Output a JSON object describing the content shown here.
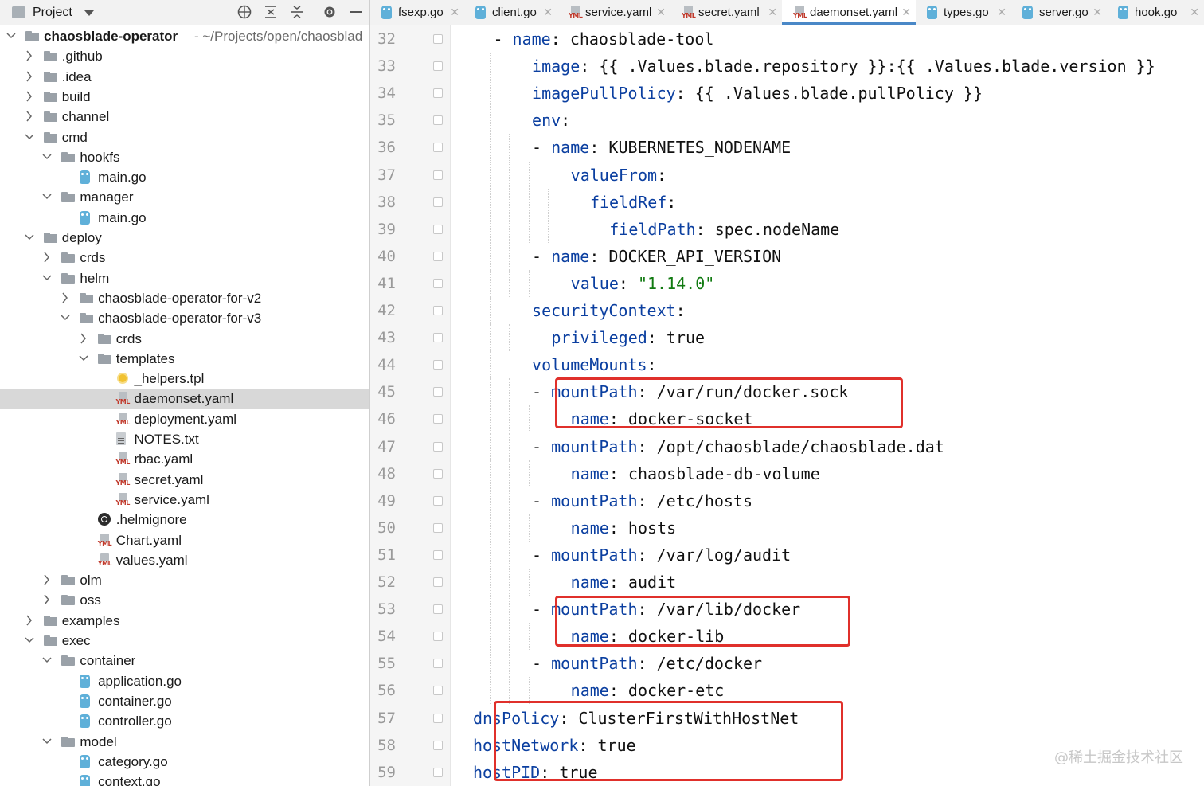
{
  "project_panel": {
    "title": "Project",
    "tree": [
      {
        "label": "chaosblade-operator",
        "hint": "- ~/Projects/open/chaosblad",
        "depth": 0,
        "expanded": true,
        "type": "module"
      },
      {
        "label": ".github",
        "depth": 1,
        "expanded": false,
        "type": "folder"
      },
      {
        "label": ".idea",
        "depth": 1,
        "expanded": false,
        "type": "folder"
      },
      {
        "label": "build",
        "depth": 1,
        "expanded": false,
        "type": "folder"
      },
      {
        "label": "channel",
        "depth": 1,
        "expanded": false,
        "type": "folder"
      },
      {
        "label": "cmd",
        "depth": 1,
        "expanded": true,
        "type": "folder"
      },
      {
        "label": "hookfs",
        "depth": 2,
        "expanded": true,
        "type": "folder"
      },
      {
        "label": "main.go",
        "depth": 3,
        "type": "go"
      },
      {
        "label": "manager",
        "depth": 2,
        "expanded": true,
        "type": "folder"
      },
      {
        "label": "main.go",
        "depth": 3,
        "type": "go"
      },
      {
        "label": "deploy",
        "depth": 1,
        "expanded": true,
        "type": "folder"
      },
      {
        "label": "crds",
        "depth": 2,
        "expanded": false,
        "type": "folder"
      },
      {
        "label": "helm",
        "depth": 2,
        "expanded": true,
        "type": "folder"
      },
      {
        "label": "chaosblade-operator-for-v2",
        "depth": 3,
        "expanded": false,
        "type": "folder"
      },
      {
        "label": "chaosblade-operator-for-v3",
        "depth": 3,
        "expanded": true,
        "type": "folder"
      },
      {
        "label": "crds",
        "depth": 4,
        "expanded": false,
        "type": "folder"
      },
      {
        "label": "templates",
        "depth": 4,
        "expanded": true,
        "type": "folder"
      },
      {
        "label": "_helpers.tpl",
        "depth": 5,
        "type": "tpl"
      },
      {
        "label": "daemonset.yaml",
        "depth": 5,
        "type": "yml",
        "selected": true
      },
      {
        "label": "deployment.yaml",
        "depth": 5,
        "type": "yml"
      },
      {
        "label": "NOTES.txt",
        "depth": 5,
        "type": "txt"
      },
      {
        "label": "rbac.yaml",
        "depth": 5,
        "type": "yml"
      },
      {
        "label": "secret.yaml",
        "depth": 5,
        "type": "yml"
      },
      {
        "label": "service.yaml",
        "depth": 5,
        "type": "yml"
      },
      {
        "label": ".helmignore",
        "depth": 4,
        "type": "helm"
      },
      {
        "label": "Chart.yaml",
        "depth": 4,
        "type": "yml"
      },
      {
        "label": "values.yaml",
        "depth": 4,
        "type": "yml"
      },
      {
        "label": "olm",
        "depth": 2,
        "expanded": false,
        "type": "folder"
      },
      {
        "label": "oss",
        "depth": 2,
        "expanded": false,
        "type": "folder"
      },
      {
        "label": "examples",
        "depth": 1,
        "expanded": false,
        "type": "folder"
      },
      {
        "label": "exec",
        "depth": 1,
        "expanded": true,
        "type": "folder"
      },
      {
        "label": "container",
        "depth": 2,
        "expanded": true,
        "type": "folder"
      },
      {
        "label": "application.go",
        "depth": 3,
        "type": "go"
      },
      {
        "label": "container.go",
        "depth": 3,
        "type": "go"
      },
      {
        "label": "controller.go",
        "depth": 3,
        "type": "go"
      },
      {
        "label": "model",
        "depth": 2,
        "expanded": true,
        "type": "folder"
      },
      {
        "label": "category.go",
        "depth": 3,
        "type": "go"
      },
      {
        "label": "context.go",
        "depth": 3,
        "type": "go"
      }
    ]
  },
  "tabs": [
    {
      "label": "fsexp.go",
      "icon": "go"
    },
    {
      "label": "client.go",
      "icon": "go"
    },
    {
      "label": "service.yaml",
      "icon": "yml"
    },
    {
      "label": "secret.yaml",
      "icon": "yml"
    },
    {
      "label": "daemonset.yaml",
      "icon": "yml",
      "active": true
    },
    {
      "label": "types.go",
      "icon": "go"
    },
    {
      "label": "server.go",
      "icon": "go"
    },
    {
      "label": "hook.go",
      "icon": "go"
    }
  ],
  "editor": {
    "lines": [
      {
        "n": "32",
        "indent": 1,
        "dash": true,
        "key": "name",
        "val": "chaosblade-tool",
        "vtype": "plain"
      },
      {
        "n": "33",
        "indent": 2,
        "key": "image",
        "val": "{{ .Values.blade.repository }}:{{ .Values.blade.version }}",
        "vtype": "plain"
      },
      {
        "n": "34",
        "indent": 2,
        "key": "imagePullPolicy",
        "val": "{{ .Values.blade.pullPolicy }}",
        "vtype": "plain"
      },
      {
        "n": "35",
        "indent": 2,
        "key": "env",
        "val": "",
        "vtype": "plain"
      },
      {
        "n": "36",
        "indent": 3,
        "dash": true,
        "key": "name",
        "val": "KUBERNETES_NODENAME",
        "vtype": "plain"
      },
      {
        "n": "37",
        "indent": 4,
        "key": "valueFrom",
        "val": "",
        "vtype": "plain"
      },
      {
        "n": "38",
        "indent": 5,
        "key": "fieldRef",
        "val": "",
        "vtype": "plain"
      },
      {
        "n": "39",
        "indent": 6,
        "key": "fieldPath",
        "val": "spec.nodeName",
        "vtype": "plain"
      },
      {
        "n": "40",
        "indent": 3,
        "dash": true,
        "key": "name",
        "val": "DOCKER_API_VERSION",
        "vtype": "plain"
      },
      {
        "n": "41",
        "indent": 4,
        "key": "value",
        "val": "\"1.14.0\"",
        "vtype": "string"
      },
      {
        "n": "42",
        "indent": 2,
        "key": "securityContext",
        "val": "",
        "vtype": "plain"
      },
      {
        "n": "43",
        "indent": 3,
        "key": "privileged",
        "val": "true",
        "vtype": "plain"
      },
      {
        "n": "44",
        "indent": 2,
        "key": "volumeMounts",
        "val": "",
        "vtype": "plain"
      },
      {
        "n": "45",
        "indent": 3,
        "dash": true,
        "key": "mountPath",
        "val": "/var/run/docker.sock",
        "vtype": "plain"
      },
      {
        "n": "46",
        "indent": 4,
        "key": "name",
        "val": "docker-socket",
        "vtype": "plain"
      },
      {
        "n": "47",
        "indent": 3,
        "dash": true,
        "key": "mountPath",
        "val": "/opt/chaosblade/chaosblade.dat",
        "vtype": "plain"
      },
      {
        "n": "48",
        "indent": 4,
        "key": "name",
        "val": "chaosblade-db-volume",
        "vtype": "plain"
      },
      {
        "n": "49",
        "indent": 3,
        "dash": true,
        "key": "mountPath",
        "val": "/etc/hosts",
        "vtype": "plain"
      },
      {
        "n": "50",
        "indent": 4,
        "key": "name",
        "val": "hosts",
        "vtype": "plain"
      },
      {
        "n": "51",
        "indent": 3,
        "dash": true,
        "key": "mountPath",
        "val": "/var/log/audit",
        "vtype": "plain"
      },
      {
        "n": "52",
        "indent": 4,
        "key": "name",
        "val": "audit",
        "vtype": "plain"
      },
      {
        "n": "53",
        "indent": 3,
        "dash": true,
        "key": "mountPath",
        "val": "/var/lib/docker",
        "vtype": "plain"
      },
      {
        "n": "54",
        "indent": 4,
        "key": "name",
        "val": "docker-lib",
        "vtype": "plain"
      },
      {
        "n": "55",
        "indent": 3,
        "dash": true,
        "key": "mountPath",
        "val": "/etc/docker",
        "vtype": "plain"
      },
      {
        "n": "56",
        "indent": 4,
        "key": "name",
        "val": "docker-etc",
        "vtype": "plain"
      },
      {
        "n": "57",
        "indent": 0,
        "key": "dnsPolicy",
        "val": "ClusterFirstWithHostNet",
        "vtype": "plain"
      },
      {
        "n": "58",
        "indent": 0,
        "key": "hostNetwork",
        "val": "true",
        "vtype": "plain"
      },
      {
        "n": "59",
        "indent": 0,
        "key": "hostPID",
        "val": "true",
        "vtype": "plain"
      }
    ]
  },
  "annotations": {
    "highlight_color": "#e0302b"
  },
  "watermark": "@稀土掘金技术社区",
  "colors": {
    "key": "#0b3fa0",
    "string": "#117a11",
    "active_tab_underline": "#4a88c7",
    "selected_row": "#d8d8d8"
  }
}
